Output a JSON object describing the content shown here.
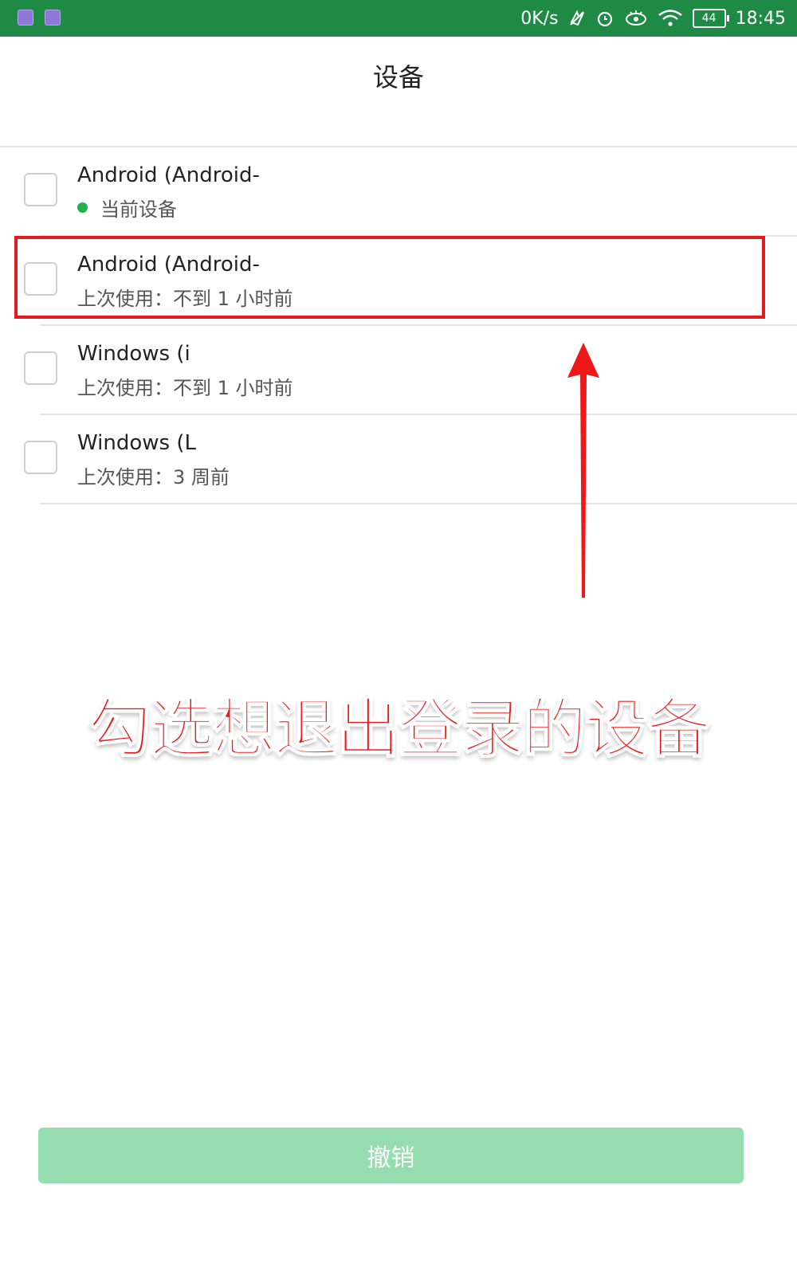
{
  "status_bar": {
    "net_speed": "0K/s",
    "battery": "44",
    "time": "18:45",
    "icons": [
      "gallery-app-icon",
      "keyboard-app-icon",
      "mute-icon",
      "alarm-icon",
      "eye-care-icon",
      "wifi-icon",
      "battery-icon"
    ]
  },
  "header": {
    "title": "设备"
  },
  "devices": [
    {
      "name": "Android (Android-",
      "sub": "当前设备",
      "current": true
    },
    {
      "name": "Android (Android-",
      "sub": "上次使用：不到 1 小时前",
      "current": false
    },
    {
      "name": "Windows (i",
      "sub": "上次使用：不到 1 小时前",
      "current": false
    },
    {
      "name": "Windows (L",
      "sub": "上次使用：3 周前",
      "current": false
    }
  ],
  "annotation": {
    "text": "勾选想退出登录的设备"
  },
  "footer": {
    "revoke_label": "撤销"
  },
  "colors": {
    "status_bar": "#1f8a45",
    "highlight": "#e51b1b",
    "current_dot": "#20b14b",
    "revoke_disabled": "#95dcae"
  }
}
